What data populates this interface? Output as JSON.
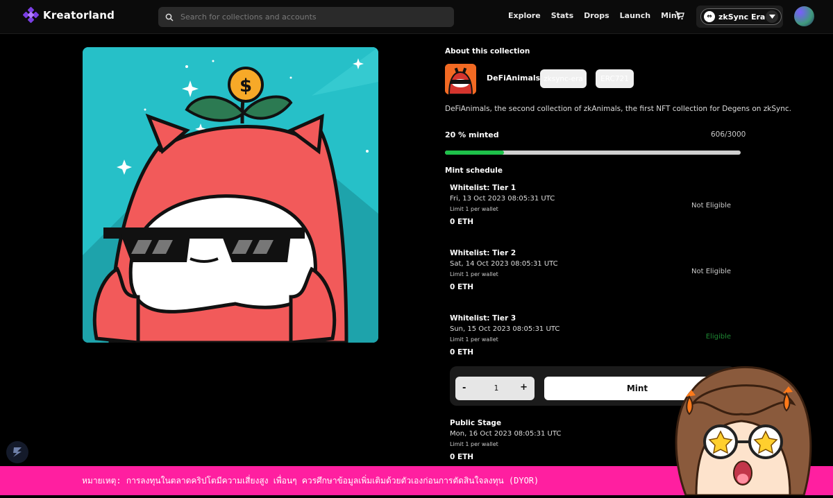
{
  "brand": {
    "name": "Kreatorland"
  },
  "search": {
    "placeholder": "Search for collections and accounts"
  },
  "nav": {
    "links": [
      "Explore",
      "Stats",
      "Drops",
      "Launch",
      "Mint"
    ]
  },
  "network": {
    "label": "zkSync Era"
  },
  "collection": {
    "section_title": "About this collection",
    "name": "DeFiAnimals",
    "chips": [
      "zksync-era",
      "ERC721"
    ],
    "description": "DeFiAnimals, the second collection of zkAnimals, the first NFT collection for Degens on zkSync.",
    "minted_label": "20 % minted",
    "minted_count": "606/3000",
    "minted_fraction": 0.2
  },
  "schedule": {
    "title": "Mint schedule",
    "tiers": [
      {
        "name": "Whitelist: Tier 1",
        "date": "Fri, 13 Oct 2023 08:05:31 UTC",
        "limit": "Limit 1 per wallet",
        "price": "0 ETH",
        "status": "Not Eligible"
      },
      {
        "name": "Whitelist: Tier 2",
        "date": "Sat, 14 Oct 2023 08:05:31 UTC",
        "limit": "Limit 1 per wallet",
        "price": "0 ETH",
        "status": "Not Eligible"
      },
      {
        "name": "Whitelist: Tier 3",
        "date": "Sun, 15 Oct 2023 08:05:31 UTC",
        "limit": "Limit 1 per wallet",
        "price": "0 ETH",
        "status": "Eligible"
      },
      {
        "name": "Public Stage",
        "date": "Mon, 16 Oct 2023 08:05:31 UTC",
        "limit": "Limit 1 per wallet",
        "price": "0 ETH",
        "status": ""
      }
    ]
  },
  "mint": {
    "minus": "-",
    "quantity": "1",
    "plus": "+",
    "button": "Mint"
  },
  "banner": {
    "text": "หมายเหตุ: การลงทุนในตลาดคริปโตมีความเสี่ยงสูง เพื่อนๆ ควรศึกษาข้อมูลเพิ่มเติมด้วยตัวเองก่อนการตัดสินใจลงทุน (DYOR)"
  },
  "colors": {
    "accent_green": "#1ec14a",
    "banner_pink": "#ff1fa0",
    "eligible_green": "#1f8a34"
  }
}
